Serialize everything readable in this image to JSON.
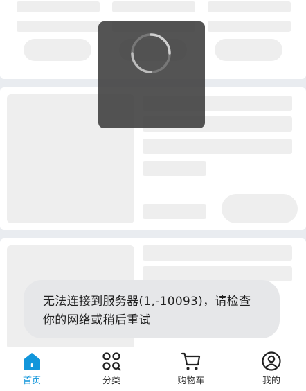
{
  "toast": {
    "line1": "无法连接到服务器(1,-10093)，请检查",
    "line2": "你的网络或稍后重试"
  },
  "tabbar": {
    "items": [
      {
        "label": "首页",
        "icon": "home-icon",
        "active": true
      },
      {
        "label": "分类",
        "icon": "category-grid-icon",
        "active": false
      },
      {
        "label": "购物车",
        "icon": "cart-icon",
        "active": false
      },
      {
        "label": "我的",
        "icon": "user-profile-icon",
        "active": false
      }
    ]
  },
  "colors": {
    "accent": "#1296db",
    "tab_text": "#333333",
    "page_background": "#e9ecf0"
  }
}
